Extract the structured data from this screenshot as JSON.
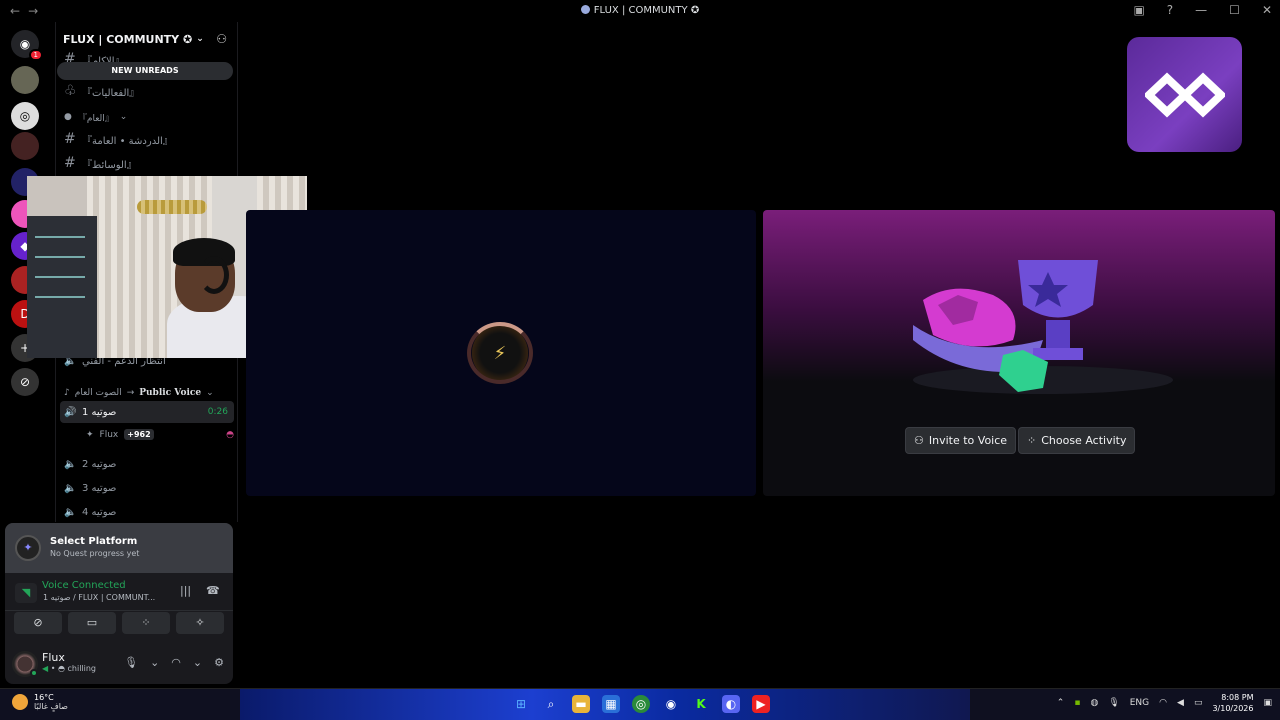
{
  "window": {
    "title": "FLUX | COMMUNTY",
    "back": "←",
    "forward": "→"
  },
  "server": {
    "name": "FLUX | COMMUNTY",
    "new_unreads": "NEW UNREADS"
  },
  "channels": {
    "top_partial": "『الاكام』",
    "events": "『الفعاليات』",
    "category_general": "『العام』",
    "general_chat": "『الدردشة • العامة』",
    "media": "『الوسائط』",
    "support_wait": "انتظار الدعم - الفني",
    "voice_category_ar": "الصوت العام",
    "voice_category_en": "Public Voice",
    "voice_1": "صوتيه 1",
    "voice_1_timer": "0:26",
    "voice_2": "صوتيه 2",
    "voice_3": "صوتيه 3",
    "voice_4": "صوتيه 4",
    "vc_user": "Flux",
    "vc_user_tag": "+962"
  },
  "quest": {
    "title": "Select Platform",
    "subtitle": "No Quest progress yet"
  },
  "voice": {
    "status": "Voice Connected",
    "location": "صوتيه 1 / FLUX | COMMUNT..."
  },
  "user": {
    "name": "Flux",
    "status": "chilling"
  },
  "activity": {
    "invite": "Invite to Voice",
    "choose": "Choose Activity"
  },
  "taskbar": {
    "temp": "16°C",
    "weather": "صافٍ غالبًا",
    "lang": "ENG",
    "time": "8:08 PM",
    "date": "3/10/2026"
  },
  "colors": {
    "accent_green": "#23a559",
    "panel_bg": "#1a1a1e",
    "logo_purple": "#7a3fc0"
  }
}
